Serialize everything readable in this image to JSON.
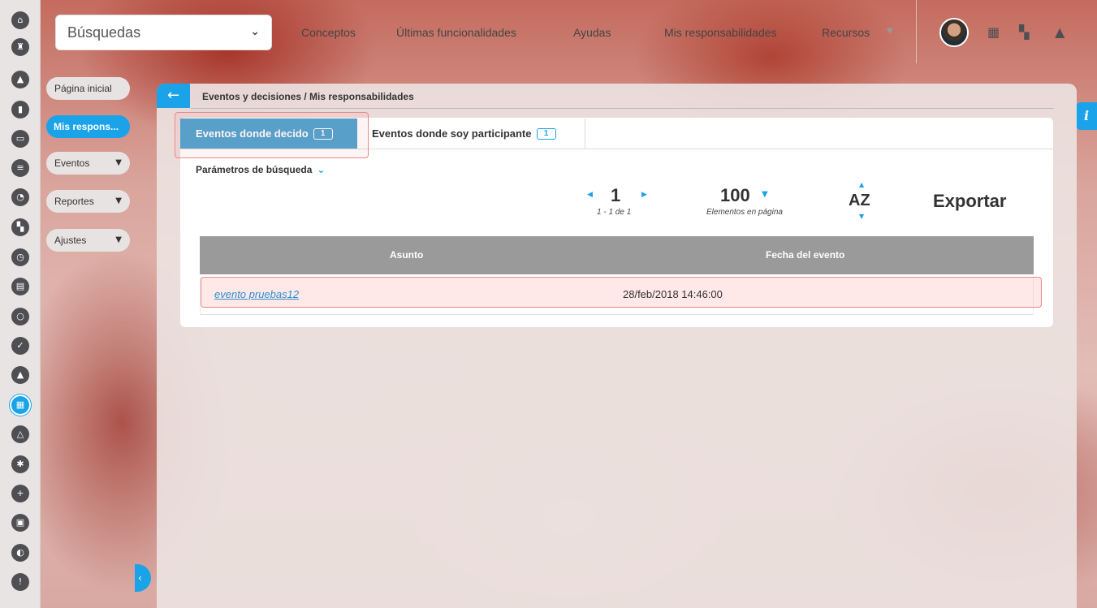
{
  "search": {
    "label": "Búsquedas"
  },
  "topnav": {
    "items": [
      "Conceptos",
      "Últimas funcionalidades",
      "Ayudas",
      "Mis responsabilidades",
      "Recursos"
    ]
  },
  "sidebar": {
    "items": [
      {
        "label": "Página inicial"
      },
      {
        "label": "Mis respons..."
      },
      {
        "label": "Eventos"
      },
      {
        "label": "Reportes"
      },
      {
        "label": "Ajustes"
      }
    ]
  },
  "info": {
    "label": "i"
  },
  "breadcrumb": "Eventos y decisiones / Mis responsabilidades",
  "tabs": [
    {
      "label": "Eventos donde decido",
      "count": "1"
    },
    {
      "label": "Eventos donde soy participante",
      "count": "1"
    }
  ],
  "params_label": "Parámetros de búsqueda",
  "pager": {
    "page": "1",
    "range": "1 - 1 de 1"
  },
  "per_page": {
    "value": "100",
    "label": "Elementos en página"
  },
  "sort": {
    "label": "AZ"
  },
  "export_label": "Exportar",
  "table": {
    "columns": [
      "Asunto",
      "Fecha del evento"
    ],
    "rows": [
      {
        "subject": "evento pruebas12",
        "date": "28/feb/2018 14:46:00"
      }
    ]
  },
  "colors": {
    "accent": "#1aa3e8",
    "active_tab": "#4aa3d2",
    "table_header": "#9a9a9a",
    "highlight": "#e88a8a"
  }
}
